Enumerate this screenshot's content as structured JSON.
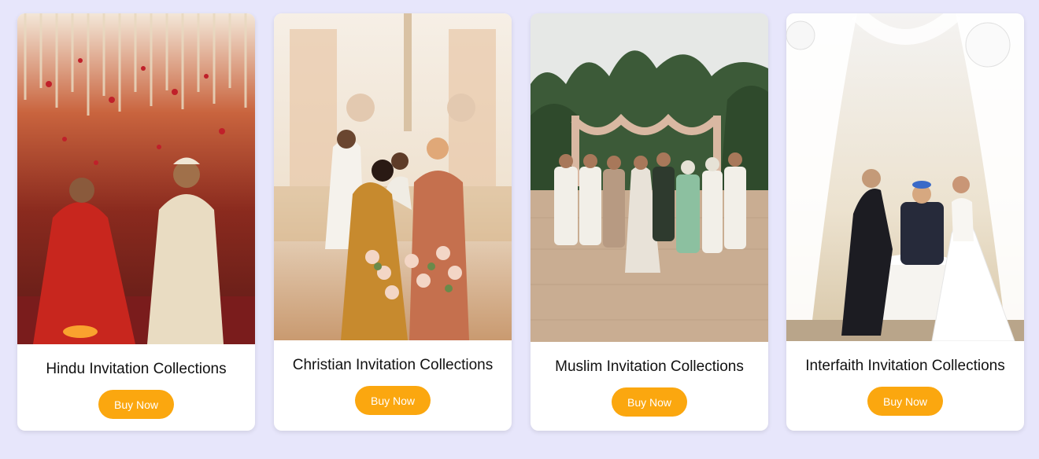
{
  "cards": [
    {
      "title": "Hindu Invitation Collections",
      "button_label": "Buy Now",
      "image": "hindu-wedding-ceremony-photo"
    },
    {
      "title": "Christian Invitation Collections",
      "button_label": "Buy Now",
      "image": "christian-church-wedding-photo"
    },
    {
      "title": "Muslim Invitation Collections",
      "button_label": "Buy Now",
      "image": "muslim-wedding-family-photo"
    },
    {
      "title": "Interfaith Invitation Collections",
      "button_label": "Buy Now",
      "image": "interfaith-wedding-ceremony-photo"
    }
  ],
  "colors": {
    "page_background": "#e7e6fb",
    "card_background": "#ffffff",
    "button": "#fba70f",
    "button_text": "#ffffff"
  }
}
